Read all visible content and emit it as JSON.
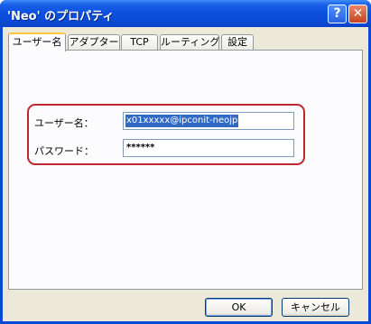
{
  "window": {
    "title": "'Neo' のプロパティ"
  },
  "titlebar_buttons": {
    "help": "?",
    "close": "✕"
  },
  "tabs": [
    {
      "label": "ユーザー名"
    },
    {
      "label": "アダプター"
    },
    {
      "label": "TCP"
    },
    {
      "label": "ルーティング"
    },
    {
      "label": "設定"
    }
  ],
  "form": {
    "username_label": "ユーザー名：",
    "username_value": "x01xxxxx@ipconit-neojp",
    "password_label": "パスワード：",
    "password_value": "******"
  },
  "buttons": {
    "ok": "OK",
    "cancel": "キャンセル"
  },
  "colors": {
    "highlight": "#c0272d",
    "titlebar": "#0a4ad4",
    "selection": "#316ac5"
  }
}
